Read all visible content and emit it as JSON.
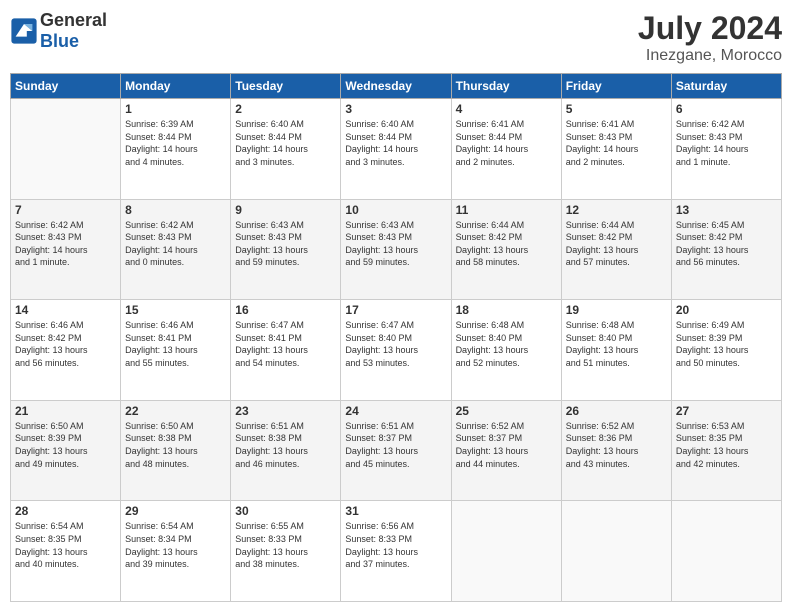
{
  "header": {
    "logo_general": "General",
    "logo_blue": "Blue",
    "month": "July 2024",
    "location": "Inezgane, Morocco"
  },
  "weekdays": [
    "Sunday",
    "Monday",
    "Tuesday",
    "Wednesday",
    "Thursday",
    "Friday",
    "Saturday"
  ],
  "weeks": [
    [
      {
        "day": "",
        "info": ""
      },
      {
        "day": "1",
        "info": "Sunrise: 6:39 AM\nSunset: 8:44 PM\nDaylight: 14 hours\nand 4 minutes."
      },
      {
        "day": "2",
        "info": "Sunrise: 6:40 AM\nSunset: 8:44 PM\nDaylight: 14 hours\nand 3 minutes."
      },
      {
        "day": "3",
        "info": "Sunrise: 6:40 AM\nSunset: 8:44 PM\nDaylight: 14 hours\nand 3 minutes."
      },
      {
        "day": "4",
        "info": "Sunrise: 6:41 AM\nSunset: 8:44 PM\nDaylight: 14 hours\nand 2 minutes."
      },
      {
        "day": "5",
        "info": "Sunrise: 6:41 AM\nSunset: 8:43 PM\nDaylight: 14 hours\nand 2 minutes."
      },
      {
        "day": "6",
        "info": "Sunrise: 6:42 AM\nSunset: 8:43 PM\nDaylight: 14 hours\nand 1 minute."
      }
    ],
    [
      {
        "day": "7",
        "info": "Sunrise: 6:42 AM\nSunset: 8:43 PM\nDaylight: 14 hours\nand 1 minute."
      },
      {
        "day": "8",
        "info": "Sunrise: 6:42 AM\nSunset: 8:43 PM\nDaylight: 14 hours\nand 0 minutes."
      },
      {
        "day": "9",
        "info": "Sunrise: 6:43 AM\nSunset: 8:43 PM\nDaylight: 13 hours\nand 59 minutes."
      },
      {
        "day": "10",
        "info": "Sunrise: 6:43 AM\nSunset: 8:43 PM\nDaylight: 13 hours\nand 59 minutes."
      },
      {
        "day": "11",
        "info": "Sunrise: 6:44 AM\nSunset: 8:42 PM\nDaylight: 13 hours\nand 58 minutes."
      },
      {
        "day": "12",
        "info": "Sunrise: 6:44 AM\nSunset: 8:42 PM\nDaylight: 13 hours\nand 57 minutes."
      },
      {
        "day": "13",
        "info": "Sunrise: 6:45 AM\nSunset: 8:42 PM\nDaylight: 13 hours\nand 56 minutes."
      }
    ],
    [
      {
        "day": "14",
        "info": "Sunrise: 6:46 AM\nSunset: 8:42 PM\nDaylight: 13 hours\nand 56 minutes."
      },
      {
        "day": "15",
        "info": "Sunrise: 6:46 AM\nSunset: 8:41 PM\nDaylight: 13 hours\nand 55 minutes."
      },
      {
        "day": "16",
        "info": "Sunrise: 6:47 AM\nSunset: 8:41 PM\nDaylight: 13 hours\nand 54 minutes."
      },
      {
        "day": "17",
        "info": "Sunrise: 6:47 AM\nSunset: 8:40 PM\nDaylight: 13 hours\nand 53 minutes."
      },
      {
        "day": "18",
        "info": "Sunrise: 6:48 AM\nSunset: 8:40 PM\nDaylight: 13 hours\nand 52 minutes."
      },
      {
        "day": "19",
        "info": "Sunrise: 6:48 AM\nSunset: 8:40 PM\nDaylight: 13 hours\nand 51 minutes."
      },
      {
        "day": "20",
        "info": "Sunrise: 6:49 AM\nSunset: 8:39 PM\nDaylight: 13 hours\nand 50 minutes."
      }
    ],
    [
      {
        "day": "21",
        "info": "Sunrise: 6:50 AM\nSunset: 8:39 PM\nDaylight: 13 hours\nand 49 minutes."
      },
      {
        "day": "22",
        "info": "Sunrise: 6:50 AM\nSunset: 8:38 PM\nDaylight: 13 hours\nand 48 minutes."
      },
      {
        "day": "23",
        "info": "Sunrise: 6:51 AM\nSunset: 8:38 PM\nDaylight: 13 hours\nand 46 minutes."
      },
      {
        "day": "24",
        "info": "Sunrise: 6:51 AM\nSunset: 8:37 PM\nDaylight: 13 hours\nand 45 minutes."
      },
      {
        "day": "25",
        "info": "Sunrise: 6:52 AM\nSunset: 8:37 PM\nDaylight: 13 hours\nand 44 minutes."
      },
      {
        "day": "26",
        "info": "Sunrise: 6:52 AM\nSunset: 8:36 PM\nDaylight: 13 hours\nand 43 minutes."
      },
      {
        "day": "27",
        "info": "Sunrise: 6:53 AM\nSunset: 8:35 PM\nDaylight: 13 hours\nand 42 minutes."
      }
    ],
    [
      {
        "day": "28",
        "info": "Sunrise: 6:54 AM\nSunset: 8:35 PM\nDaylight: 13 hours\nand 40 minutes."
      },
      {
        "day": "29",
        "info": "Sunrise: 6:54 AM\nSunset: 8:34 PM\nDaylight: 13 hours\nand 39 minutes."
      },
      {
        "day": "30",
        "info": "Sunrise: 6:55 AM\nSunset: 8:33 PM\nDaylight: 13 hours\nand 38 minutes."
      },
      {
        "day": "31",
        "info": "Sunrise: 6:56 AM\nSunset: 8:33 PM\nDaylight: 13 hours\nand 37 minutes."
      },
      {
        "day": "",
        "info": ""
      },
      {
        "day": "",
        "info": ""
      },
      {
        "day": "",
        "info": ""
      }
    ]
  ]
}
